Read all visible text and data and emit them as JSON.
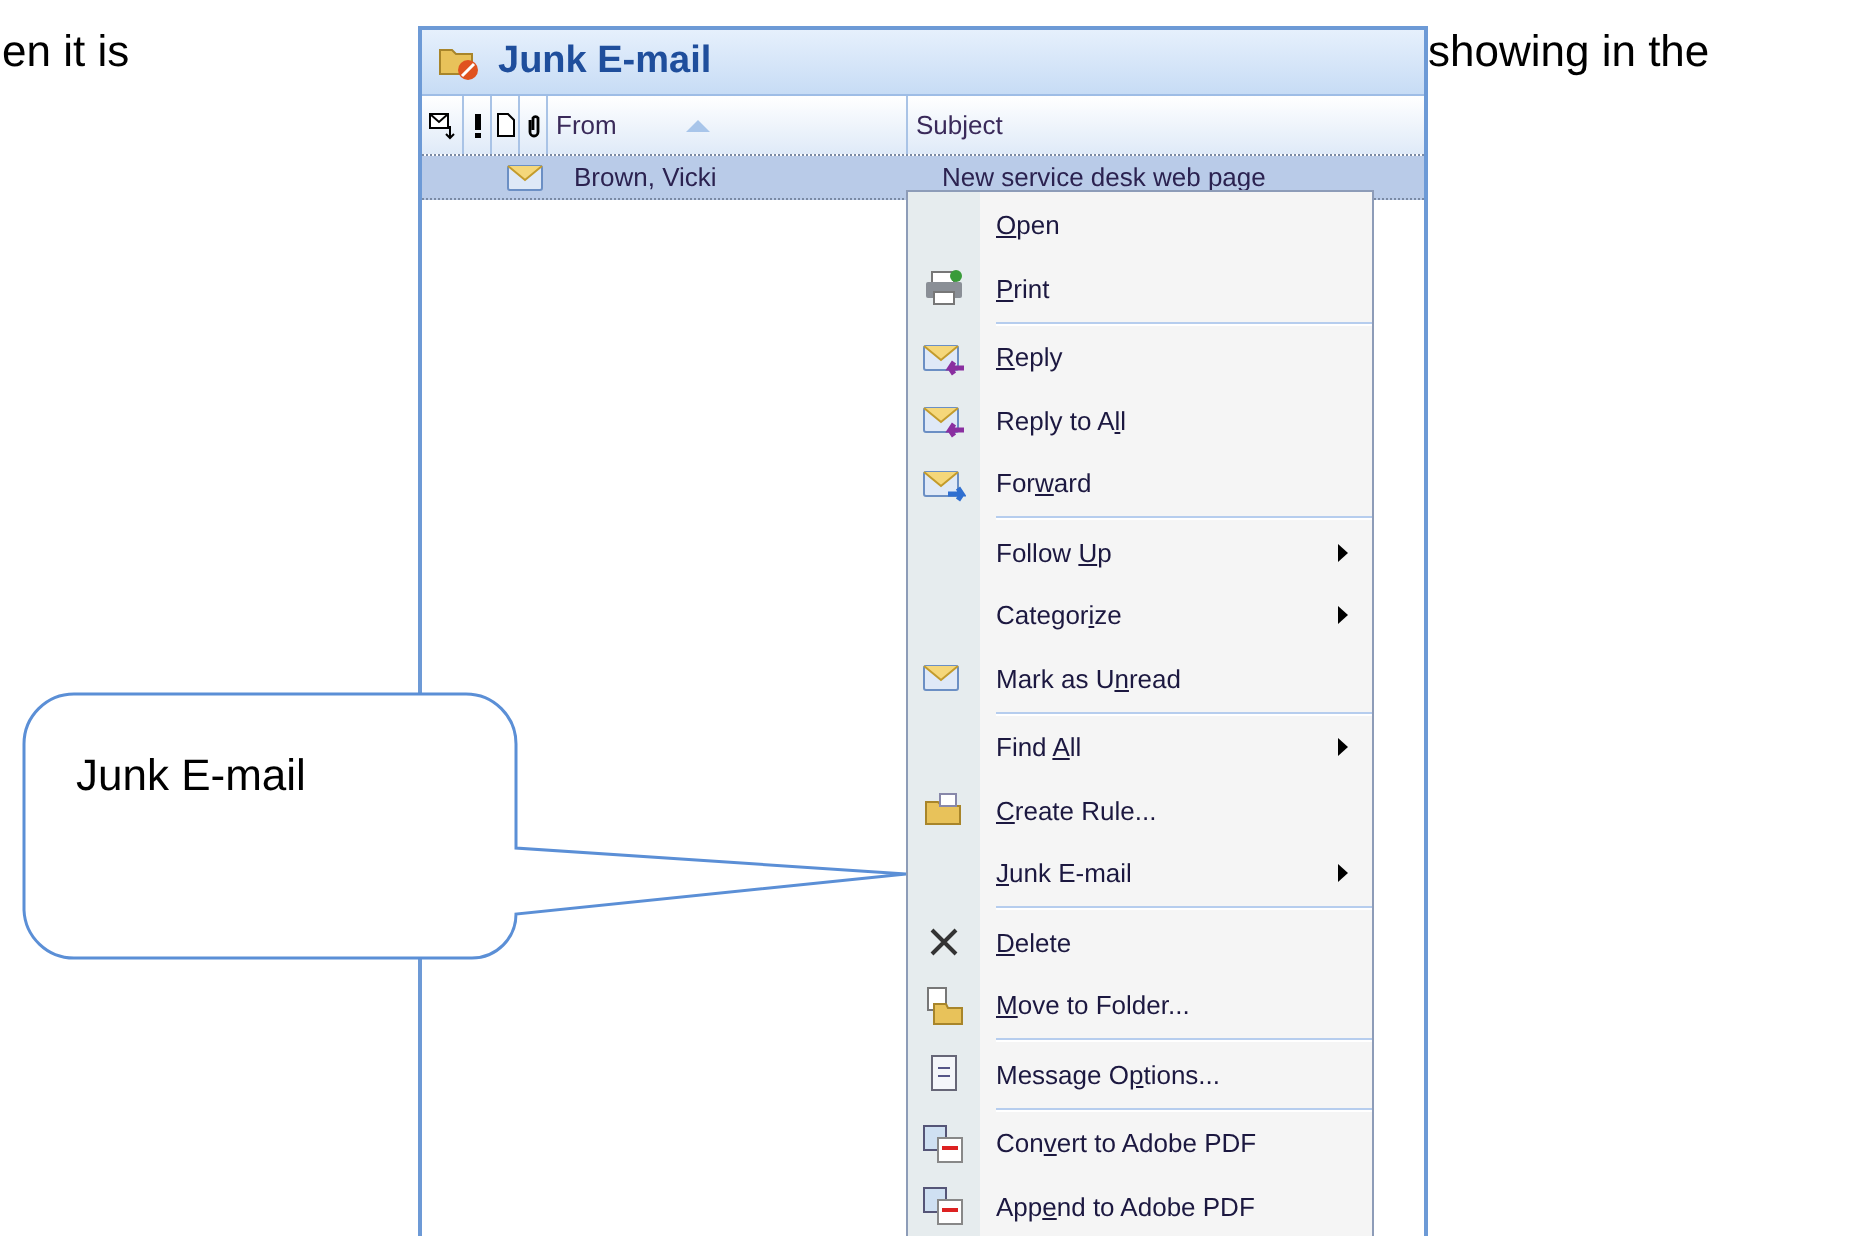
{
  "document": {
    "text_left": "en it is",
    "text_right": "showing in the"
  },
  "folder": {
    "title": "Junk E-mail"
  },
  "columns": [
    {
      "kind": "icon"
    },
    {
      "kind": "importance"
    },
    {
      "kind": "type"
    },
    {
      "kind": "attachment"
    },
    {
      "kind": "text",
      "label": "From",
      "sorted": true
    },
    {
      "kind": "text",
      "label": "Subject",
      "sorted": false
    }
  ],
  "messages": [
    {
      "from": "Brown, Vicki",
      "subject": "New service desk web page",
      "selected": true
    }
  ],
  "context_menu": {
    "groups": [
      [
        {
          "key": "O",
          "post": "pen",
          "submenu": false
        },
        {
          "key": "P",
          "post": "rint",
          "submenu": false
        }
      ],
      [
        {
          "key": "R",
          "post": "eply",
          "submenu": false
        },
        {
          "pre": "Reply to A",
          "key": "l",
          "post": "l",
          "submenu": false
        },
        {
          "pre": "For",
          "key": "w",
          "post": "ard",
          "submenu": false
        }
      ],
      [
        {
          "pre": "Follow ",
          "key": "U",
          "post": "p",
          "submenu": true
        },
        {
          "pre": "Categor",
          "key": "i",
          "post": "ze",
          "submenu": true
        },
        {
          "pre": "Mark as U",
          "key": "n",
          "post": "read",
          "submenu": false
        }
      ],
      [
        {
          "pre": "Find ",
          "key": "A",
          "post": "ll",
          "submenu": true
        },
        {
          "key": "C",
          "post": "reate Rule...",
          "submenu": false
        },
        {
          "key": "J",
          "post": "unk E-mail",
          "submenu": true
        }
      ],
      [
        {
          "key": "D",
          "post": "elete",
          "submenu": false
        },
        {
          "key": "M",
          "post": "ove to Folder...",
          "submenu": false
        }
      ],
      [
        {
          "pre": "Message O",
          "key": "p",
          "post": "tions...",
          "submenu": false
        }
      ],
      [
        {
          "pre": "Con",
          "key": "v",
          "post": "ert to Adobe PDF",
          "submenu": false
        },
        {
          "pre": "App",
          "key": "e",
          "post": "nd to Adobe PDF",
          "submenu": false
        }
      ]
    ]
  },
  "callout": {
    "text": "Junk E-mail"
  }
}
